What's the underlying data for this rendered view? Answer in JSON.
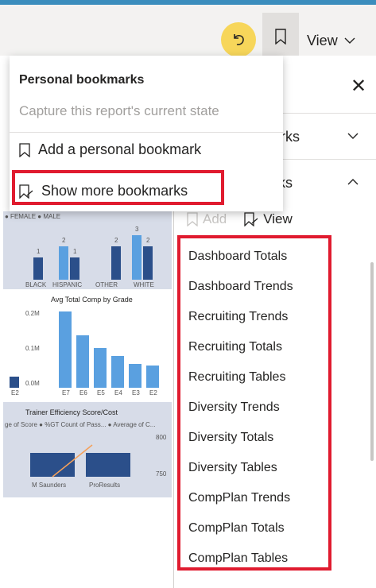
{
  "toolbar": {
    "view_label": "View"
  },
  "popup": {
    "title": "Personal bookmarks",
    "subtitle": "Capture this report's current state",
    "add_label": "Add a personal bookmark",
    "show_more_label": "Show more bookmarks"
  },
  "pane": {
    "section1_label": "kmarks",
    "section2_label": "marks",
    "add_label": "Add",
    "view_label": "View",
    "bookmarks": [
      "Dashboard Totals",
      "Dashboard Trends",
      "Recruiting Trends",
      "Recruiting Totals",
      "Recruiting Tables",
      "Diversity Trends",
      "Diversity Totals",
      "Diversity Tables",
      "CompPlan Trends",
      "CompPlan Totals",
      "CompPlan Tables"
    ]
  },
  "canvas": {
    "gender_legend": "● FEMALE ● MALE",
    "gender_categories": [
      "BLACK",
      "HISPANIC",
      "OTHER",
      "WHITE"
    ],
    "gender_values": [
      1,
      2,
      1,
      2,
      3,
      2
    ],
    "grade_title": "Avg Total Comp by Grade",
    "grade_axis": [
      "0.2M",
      "0.1M",
      "0.0M"
    ],
    "grade_categories": [
      "E7",
      "E6",
      "E5",
      "E4",
      "E3",
      "E2"
    ],
    "left_cat": "E2",
    "trainer_title": "Trainer Efficiency Score/Cost",
    "trainer_legend": "ge of Score ● %GT Count of Pass... ● Average of C...",
    "trainer_axis": [
      "800",
      "750"
    ],
    "trainer_categories": [
      "M Saunders",
      "ProResults"
    ]
  },
  "colors": {
    "accent_red": "#e01b2f",
    "undo_yellow": "#f7d65a",
    "bar_dark": "#2b4f8a",
    "bar_light": "#5aa0e0"
  }
}
